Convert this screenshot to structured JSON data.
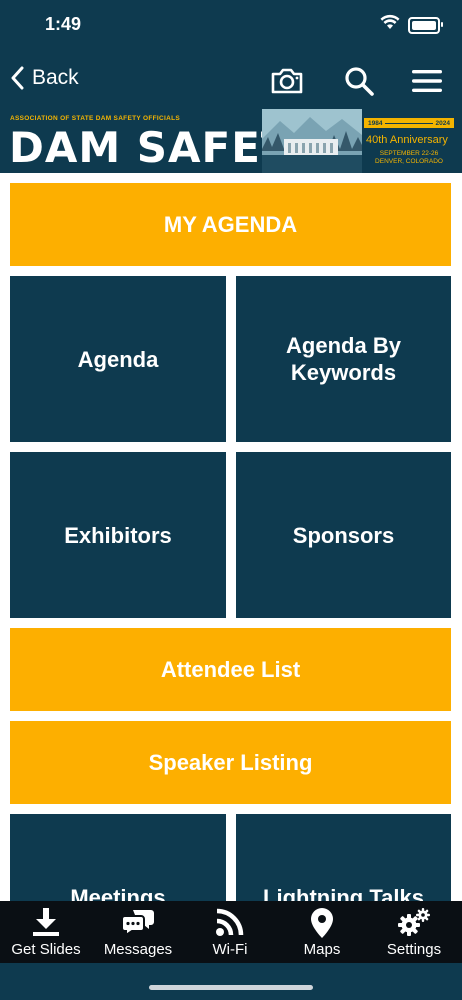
{
  "status": {
    "time": "1:49"
  },
  "nav": {
    "back_label": "Back"
  },
  "banner": {
    "org": "ASSOCIATION OF STATE DAM SAFETY OFFICIALS",
    "title": "DAM SAFETY",
    "year_start": "1984",
    "year_end": "2024",
    "anniversary": "40th Anniversary",
    "dates": "SEPTEMBER 22-26",
    "location": "DENVER, COLORADO"
  },
  "tiles": {
    "my_agenda": "MY AGENDA",
    "agenda": "Agenda",
    "agenda_by_keywords": "Agenda By Keywords",
    "exhibitors": "Exhibitors",
    "sponsors": "Sponsors",
    "attendee_list": "Attendee List",
    "speaker_listing": "Speaker Listing",
    "meetings": "Meetings",
    "lightning_talks": "Lightning Talks"
  },
  "tabs": [
    {
      "label": "Get Slides",
      "icon": "download-icon"
    },
    {
      "label": "Messages",
      "icon": "chat-icon"
    },
    {
      "label": "Wi-Fi",
      "icon": "wifi-icon"
    },
    {
      "label": "Maps",
      "icon": "map-pin-icon"
    },
    {
      "label": "Settings",
      "icon": "gear-icon"
    }
  ],
  "colors": {
    "navy": "#0e3a4f",
    "yellow": "#fdaf00",
    "tabbar": "#0a0f14"
  }
}
